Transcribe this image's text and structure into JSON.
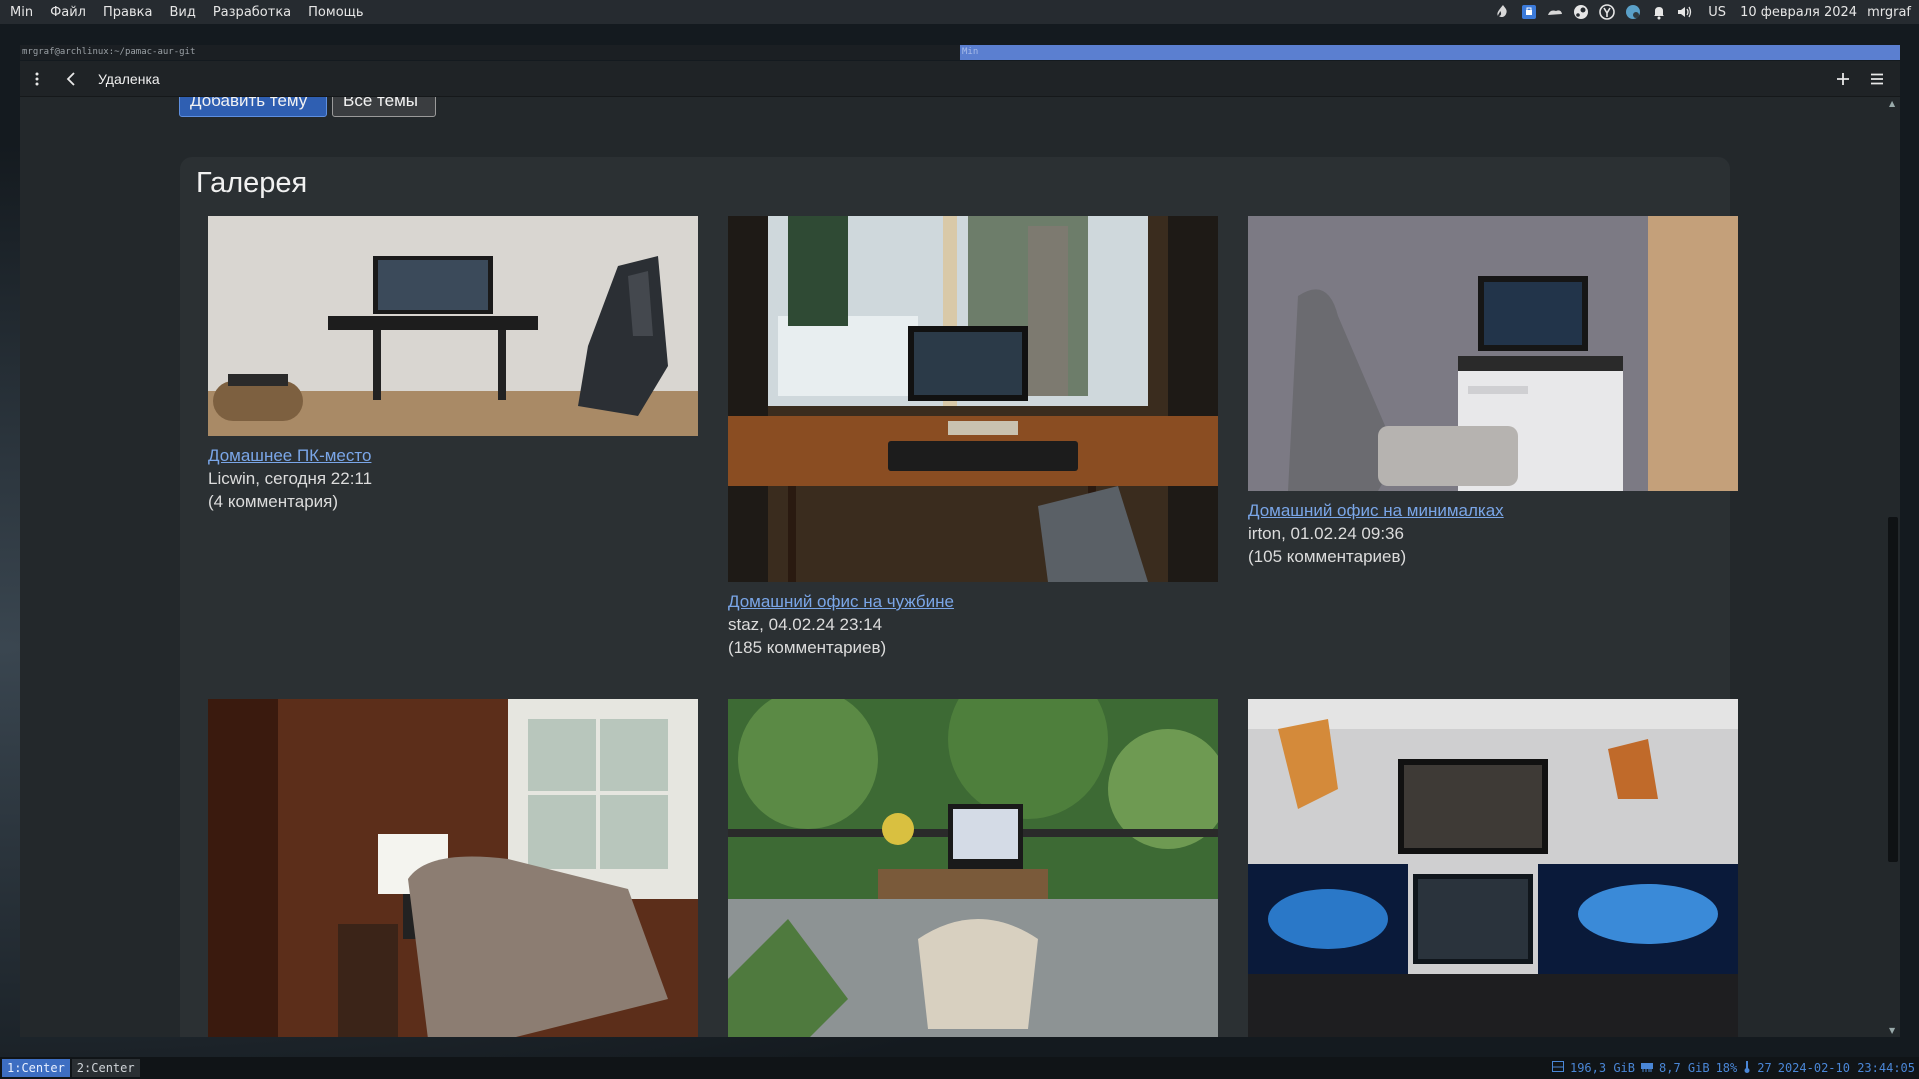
{
  "menubar": {
    "items": [
      "Min",
      "Файл",
      "Правка",
      "Вид",
      "Разработка",
      "Помощь"
    ],
    "tray_icons": [
      "flame-icon",
      "shield-icon",
      "cloud-icon",
      "steam-icon",
      "yubikey-icon",
      "network-icon",
      "bell-icon",
      "volume-icon"
    ],
    "keyboard_layout": "US",
    "date": "10 февраля 2024",
    "user": "mrgraf"
  },
  "terminal_bar": {
    "left": "mrgraf@archlinux:~/pamac-aur-git",
    "right": "Min"
  },
  "browser": {
    "tab_title": "Удаленка",
    "buttons": {
      "add_topic": "Добавить тему",
      "all_topics": "Все темы"
    }
  },
  "gallery": {
    "title": "Галерея",
    "cards": [
      {
        "title": "Домашнее ПК-место",
        "meta": "Licwin, сегодня 22:11",
        "comments": "(4 комментария)"
      },
      {
        "title": "Домашний офис на чужбине",
        "meta": "staz, 04.02.24 23:14",
        "comments": "(185 комментариев)"
      },
      {
        "title": "Домашний офис на минималках",
        "meta": "irton, 01.02.24 09:36",
        "comments": "(105 комментариев)"
      }
    ]
  },
  "statusbar": {
    "workspaces": [
      "1:Center",
      "2:Center"
    ],
    "disk": "196,3 GiB",
    "memory": "8,7 GiB",
    "cpu": "18%",
    "temp": "27",
    "datetime": "2024-02-10 23:44:05"
  },
  "colors": {
    "accent": "#2f5fb2",
    "link": "#7aa6e8",
    "statusbar_text": "#4a86d6",
    "tmux_active": "#5b7fd0"
  }
}
